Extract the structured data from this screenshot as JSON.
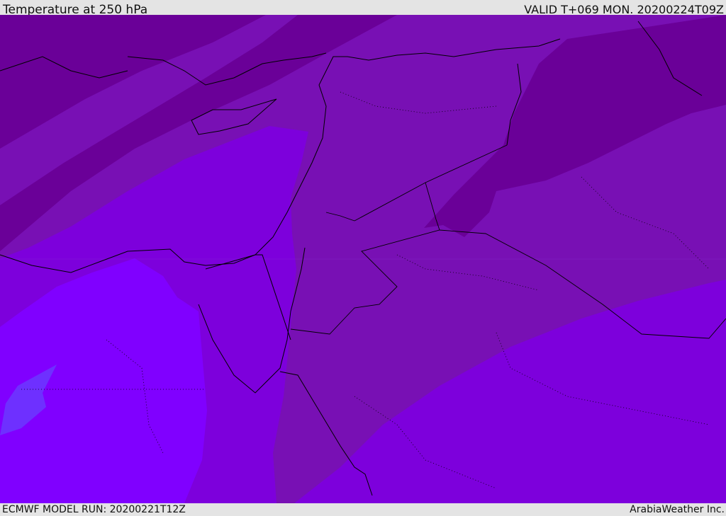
{
  "header": {
    "title": "Temperature at 250 hPa",
    "valid": "VALID T+069 MON. 20200224T09Z"
  },
  "footer": {
    "model_run": "ECMWF MODEL RUN: 20200221T12Z",
    "credit": "ArabiaWeather Inc."
  },
  "colors": {
    "coldest": "#6a0098",
    "cold": "#7810b4",
    "mid": "#7d00dc",
    "warm": "#8000ff",
    "warmest": "#6e30ff"
  }
}
